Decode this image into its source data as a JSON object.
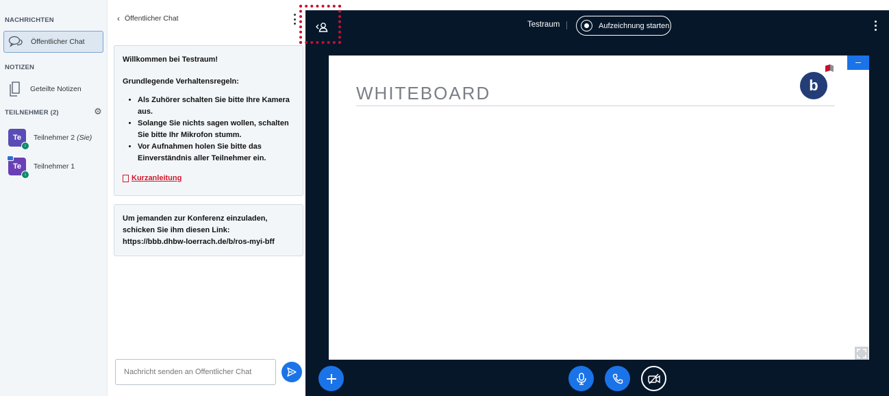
{
  "userlist": {
    "messages_title": "NACHRICHTEN",
    "public_chat_label": "Öffentlicher Chat",
    "notes_title": "NOTIZEN",
    "shared_notes_label": "Geteilte Notizen",
    "participants_title": "TEILNEHMER (2)",
    "participants": [
      {
        "initials": "Te",
        "name": "Teilnehmer 2",
        "suffix": "(Sie)"
      },
      {
        "initials": "Te",
        "name": "Teilnehmer 1",
        "suffix": ""
      }
    ]
  },
  "chat": {
    "header": "Öffentlicher Chat",
    "welcome": {
      "title": "Willkommen bei Testraum!",
      "rules_heading": "Grundlegende Verhaltensregeln:",
      "rules": [
        "Als Zuhörer schalten Sie bitte Ihre Kamera aus.",
        "Solange Sie nichts sagen wollen, schalten Sie bitte Ihr Mikrofon stumm.",
        "Vor Aufnahmen holen Sie bitte das Einverständnis aller Teilnehmer ein."
      ],
      "link_label": "Kurzanleitung"
    },
    "invite_text": "Um jemanden zur Konferenz einzuladen, schicken Sie ihm diesen Link: https://bbb.dhbw-loerrach.de/b/ros-myi-bff",
    "input_placeholder": "Nachricht senden an Öffentlicher Chat"
  },
  "main": {
    "room_title": "Testraum",
    "record_label": "Aufzeichnung starten",
    "slide_title": "WHITEBOARD",
    "logo_letter": "b",
    "minimize_label": "–"
  },
  "colors": {
    "accent": "#1b73e8",
    "main_bg": "#06172a",
    "highlight": "#c8102e",
    "link_red": "#d0192d"
  }
}
